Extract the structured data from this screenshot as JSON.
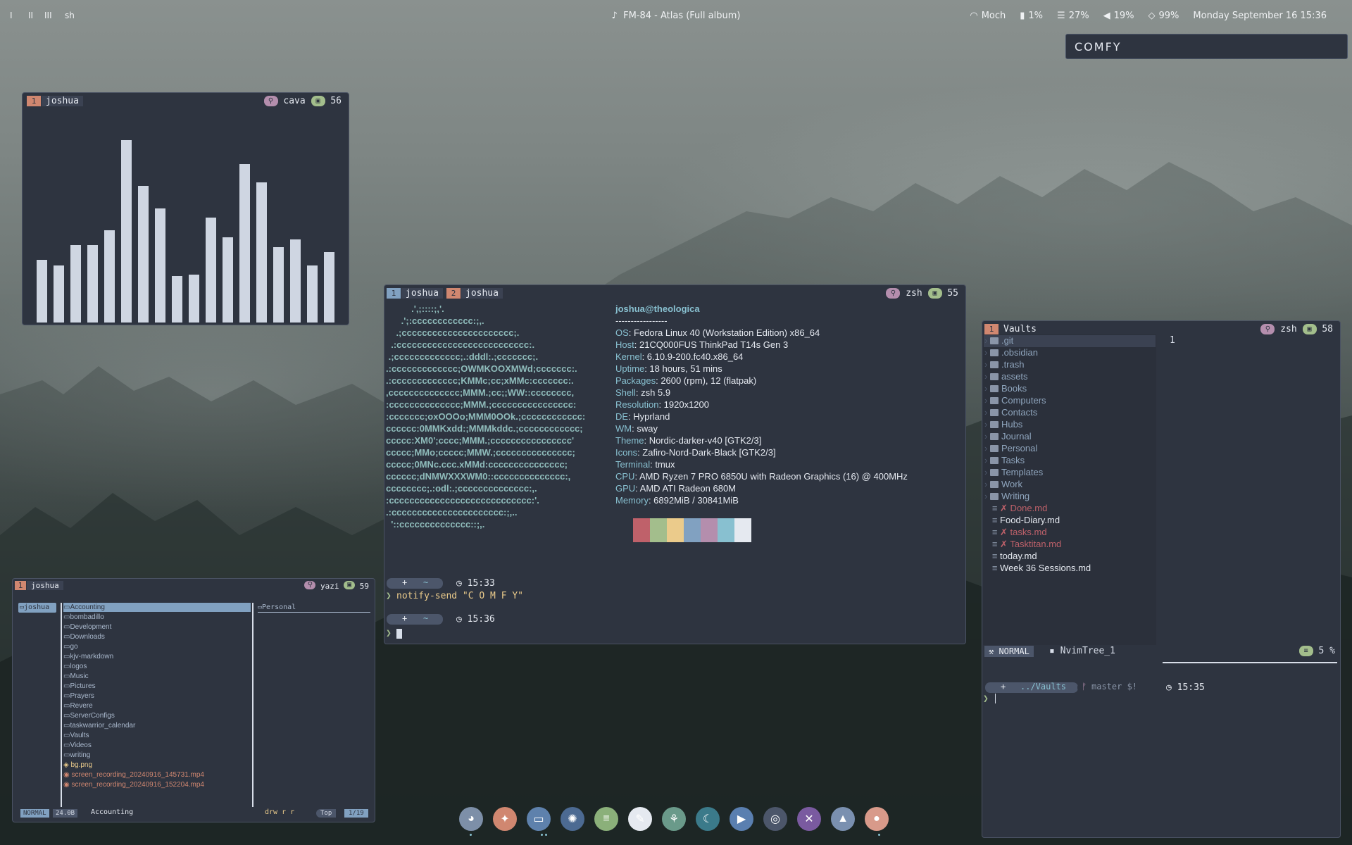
{
  "topbar": {
    "workspaces": [
      "I",
      "II",
      "III"
    ],
    "active_app": "sh",
    "music": "FM-84 - Atlas (Full album)",
    "wifi": "Moch",
    "disk": "1%",
    "memory": "27%",
    "volume": "19%",
    "battery": "99%",
    "datetime": "Monday September 16  15:36"
  },
  "notification": {
    "text": "COMFY"
  },
  "cava_window": {
    "tab_num": "1",
    "tab_label": "joshua",
    "program": "cava",
    "pane": "56",
    "bar_levels": [
      0.34,
      0.31,
      0.42,
      0.42,
      0.5,
      0.99,
      0.74,
      0.62,
      0.25,
      0.26,
      0.57,
      0.46,
      0.86,
      0.76,
      0.41,
      0.45,
      0.31,
      0.38
    ]
  },
  "fetch_window": {
    "tabs": [
      {
        "num": "1",
        "label": "joshua"
      },
      {
        "num": "2",
        "label": "joshua"
      }
    ],
    "program": "zsh",
    "pane": "55",
    "user_host": "joshua@theologica",
    "separator": "-----------------",
    "info": [
      {
        "k": "OS",
        "v": "Fedora Linux 40 (Workstation Edition) x86_64"
      },
      {
        "k": "Host",
        "v": "21CQ000FUS ThinkPad T14s Gen 3"
      },
      {
        "k": "Kernel",
        "v": "6.10.9-200.fc40.x86_64"
      },
      {
        "k": "Uptime",
        "v": "18 hours, 51 mins"
      },
      {
        "k": "Packages",
        "v": "2600 (rpm), 12 (flatpak)"
      },
      {
        "k": "Shell",
        "v": "zsh 5.9"
      },
      {
        "k": "Resolution",
        "v": "1920x1200"
      },
      {
        "k": "DE",
        "v": "Hyprland"
      },
      {
        "k": "WM",
        "v": "sway"
      },
      {
        "k": "Theme",
        "v": "Nordic-darker-v40 [GTK2/3]"
      },
      {
        "k": "Icons",
        "v": "Zafiro-Nord-Dark-Black [GTK2/3]"
      },
      {
        "k": "Terminal",
        "v": "tmux"
      },
      {
        "k": "CPU",
        "v": "AMD Ryzen 7 PRO 6850U with Radeon Graphics (16) @ 400MHz"
      },
      {
        "k": "GPU",
        "v": "AMD ATI Radeon 680M"
      },
      {
        "k": "Memory",
        "v": "6892MiB / 30841MiB"
      }
    ],
    "logo": [
      "          .',;::::;,'.",
      "      .';:cccccccccccc:;,.",
      "    .;cccccccccccccccccccccc;.",
      "  .:cccccccccccccccccccccccccc:.",
      " .;ccccccccccccc;.:dddl:.;ccccccc;.",
      ".:ccccccccccccc;OWMKOOXMWd;ccccccc:.",
      ".:ccccccccccccc;KMMc;cc;xMMc:ccccccc:.",
      ",cccccccccccccc;MMM.;cc;;WW::cccccccc,",
      ":cccccccccccccc;MMM.;cccccccccccccccc:",
      ":ccccccc;oxOOOo;MMM0OOk.;cccccccccccc:",
      "cccccc:0MMKxdd:;MMMkddc.;cccccccccccc;",
      "ccccc:XM0';cccc;MMM.;cccccccccccccccc'",
      "ccccc;MMo;ccccc;MMW.;ccccccccccccccc;",
      "ccccc;0MNc.ccc.xMMd:ccccccccccccccc;",
      "cccccc;dNMWXXXWM0::cccccccccccccc:,",
      "cccccccc;.:odl:.;cccccccccccccc:,.",
      ":cccccccccccccccccccccccccccc:'.",
      ".:cccccccccccccccccccccc:;,..",
      "  '::cccccccccccccc::;,."
    ],
    "palette": [
      "#2e3440",
      "#bf616a",
      "#a3be8c",
      "#ebcb8b",
      "#81a1c1",
      "#b48ead",
      "#88c0d0",
      "#e5e9f0"
    ],
    "prompt1_time": "15:33",
    "prompt1_tilde": "~",
    "prompt1_cmd": "notify-send \"C O M F Y\"",
    "prompt2_time": "15:36",
    "prompt2_tilde": "~",
    "prompt_symbol": "❯"
  },
  "nvim_window": {
    "tab_num": "1",
    "tab_label": "Vaults",
    "program": "zsh",
    "pane": "58",
    "line_number": "1",
    "tree": [
      {
        "name": ".git",
        "type": "dir"
      },
      {
        "name": ".obsidian",
        "type": "dir"
      },
      {
        "name": ".trash",
        "type": "dir"
      },
      {
        "name": "assets",
        "type": "dir"
      },
      {
        "name": "Books",
        "type": "dir"
      },
      {
        "name": "Computers",
        "type": "dir"
      },
      {
        "name": "Contacts",
        "type": "dir"
      },
      {
        "name": "Hubs",
        "type": "dir"
      },
      {
        "name": "Journal",
        "type": "dir"
      },
      {
        "name": "Personal",
        "type": "dir"
      },
      {
        "name": "Tasks",
        "type": "dir"
      },
      {
        "name": "Templates",
        "type": "dir"
      },
      {
        "name": "Work",
        "type": "dir"
      },
      {
        "name": "Writing",
        "type": "dir"
      },
      {
        "name": "✗ Done.md",
        "type": "mod"
      },
      {
        "name": "Food-Diary.md",
        "type": "file"
      },
      {
        "name": "✗ tasks.md",
        "type": "mod"
      },
      {
        "name": "✗ Tasktitan.md",
        "type": "mod"
      },
      {
        "name": "today.md",
        "type": "file"
      },
      {
        "name": "Week 36 Sessions.md",
        "type": "file"
      }
    ],
    "mode": "NORMAL",
    "buffer": "NvimTree_1",
    "percent": "5 %",
    "prompt_path": "../Vaults",
    "prompt_branch": "master $!",
    "prompt_time": "15:35"
  },
  "yazi_window": {
    "tab_num": "1",
    "tab_label": "joshua",
    "program": "yazi",
    "pane": "59",
    "parent": "joshua",
    "items": [
      {
        "name": "Accounting",
        "type": "dir"
      },
      {
        "name": "bombadillo",
        "type": "dir"
      },
      {
        "name": "Development",
        "type": "dir"
      },
      {
        "name": "Downloads",
        "type": "dir"
      },
      {
        "name": "go",
        "type": "dir"
      },
      {
        "name": "kjv-markdown",
        "type": "dir"
      },
      {
        "name": "logos",
        "type": "dir"
      },
      {
        "name": "Music",
        "type": "dir"
      },
      {
        "name": "Pictures",
        "type": "dir"
      },
      {
        "name": "Prayers",
        "type": "dir"
      },
      {
        "name": "Revere",
        "type": "dir"
      },
      {
        "name": "ServerConfigs",
        "type": "dir"
      },
      {
        "name": "taskwarrior_calendar",
        "type": "dir"
      },
      {
        "name": "Vaults",
        "type": "dir"
      },
      {
        "name": "Videos",
        "type": "dir"
      },
      {
        "name": "writing",
        "type": "dir"
      },
      {
        "name": "bg.png",
        "type": "file"
      },
      {
        "name": "screen_recording_20240916_145731.mp4",
        "type": "vid"
      },
      {
        "name": "screen_recording_20240916_152204.mp4",
        "type": "vid"
      }
    ],
    "preview": "Personal",
    "mode": "NORMAL",
    "size": "24.0B",
    "current": "Accounting",
    "perms": "drw r  r",
    "position": "Top",
    "count": "1/19"
  },
  "dock": {
    "icons": [
      "finder-icon",
      "firefox-icon",
      "files-icon",
      "stellarium-icon",
      "notes-icon",
      "inkscape-icon",
      "dolphin-icon",
      "vscodium-icon",
      "video-player-icon",
      "obs-icon",
      "krita-icon",
      "nordpass-icon",
      "apple-icon"
    ],
    "colors": [
      "#7d8fa8",
      "#d08770",
      "#5e81ac",
      "#4c6a92",
      "#8bb07a",
      "#e5e9f0",
      "#6a9a8a",
      "#3b7a8a",
      "#5a7fb0",
      "#4c566a",
      "#7a5aa0",
      "#7a90b0",
      "#d89a8a"
    ]
  }
}
